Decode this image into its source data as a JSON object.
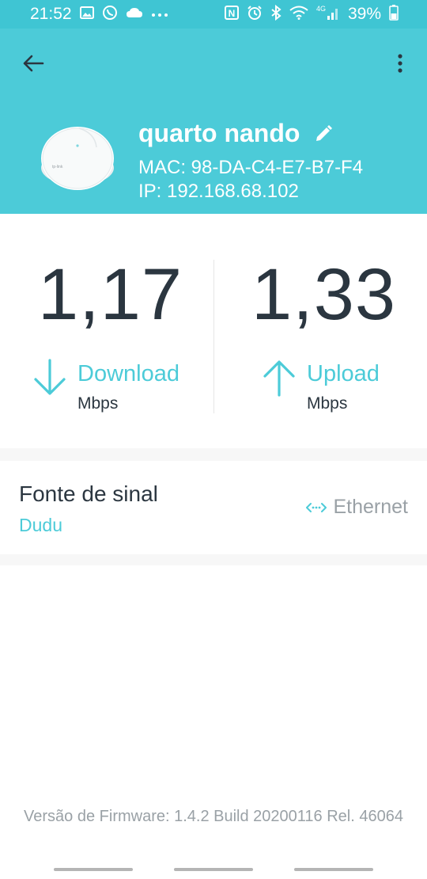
{
  "status_bar": {
    "time": "21:52",
    "battery_percent": "39%",
    "network": "4G",
    "icons": [
      "image-icon",
      "whatsapp-icon",
      "cloud-icon",
      "more-dots-icon",
      "nfc-icon",
      "alarm-icon",
      "bluetooth-icon",
      "wifi-icon",
      "signal-icon",
      "battery-icon"
    ]
  },
  "header": {
    "device_name": "quarto nando",
    "mac": "MAC: 98-DA-C4-E7-B7-F4",
    "ip": "IP: 192.168.68.102",
    "background_color": "#4ccbd8"
  },
  "speeds": {
    "download": {
      "value": "1,17",
      "label": "Download",
      "unit": "Mbps"
    },
    "upload": {
      "value": "1,33",
      "label": "Upload",
      "unit": "Mbps"
    }
  },
  "signal": {
    "title": "Fonte de sinal",
    "source": "Dudu",
    "connection_type": "Ethernet"
  },
  "footer": {
    "firmware": "Versão de Firmware: 1.4.2 Build 20200116 Rel. 46064"
  },
  "colors": {
    "accent": "#4ccbd8",
    "text_dark": "#2b3640",
    "text_muted": "#9aa1a6"
  }
}
